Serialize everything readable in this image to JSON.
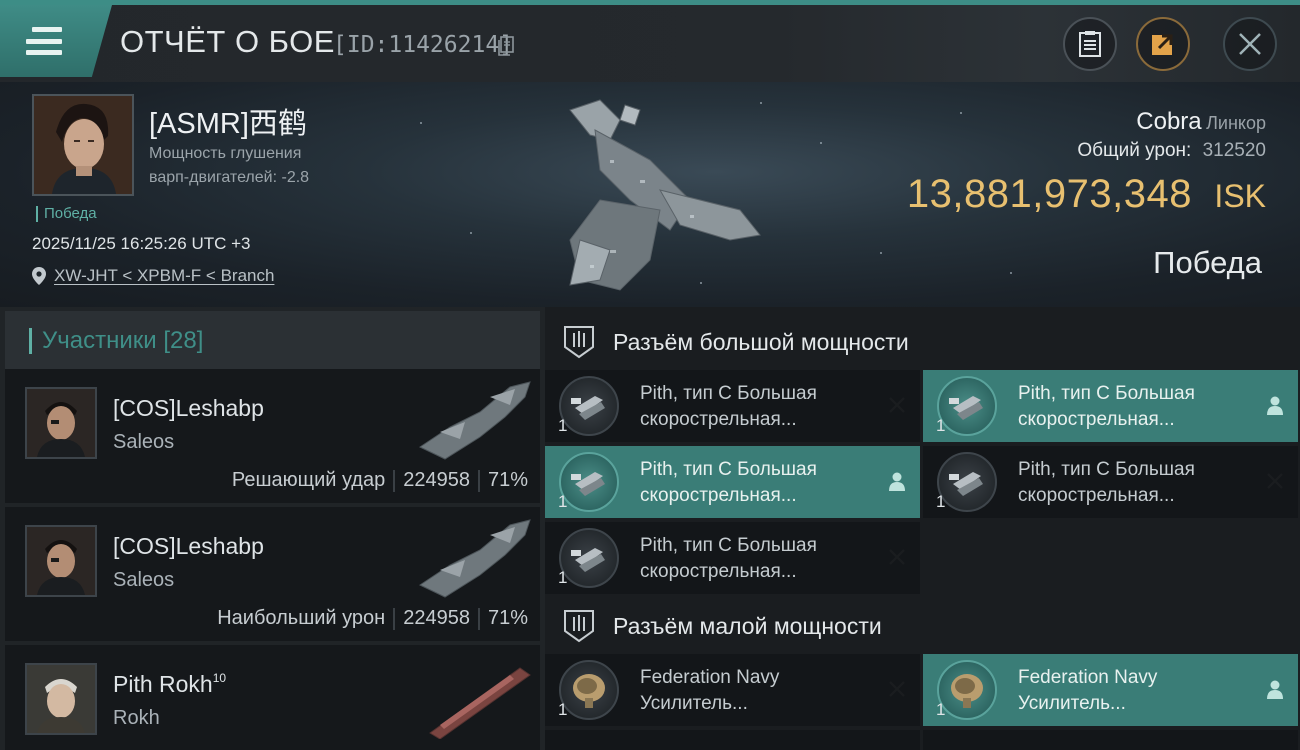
{
  "header": {
    "title": "ОТЧЁТ О БОЕ",
    "report_id": "[ID:11426214]"
  },
  "hero": {
    "pilot_name": "[ASMR]西鹤",
    "stat_line1": "Мощность глушения",
    "stat_line2": "варп-двигателей: -2.8",
    "status_tag": "Победа",
    "timestamp": "2025/11/25 16:25:26 UTC +3",
    "location": "XW-JHT < XPBM-F < Branch",
    "ship_name": "Cobra",
    "ship_class": "Линкор",
    "damage_label": "Общий урон:",
    "damage_value": "312520",
    "isk_value": "13,881,973,348",
    "isk_unit": "ISK",
    "result": "Победа"
  },
  "participants": {
    "title": "Участники [28]",
    "items": [
      {
        "name": "[COS]Leshabp",
        "sup": "",
        "ship": "Saleos",
        "role": "Решающий удар",
        "damage": "224958",
        "percent": "71%"
      },
      {
        "name": "[COS]Leshabp",
        "sup": "",
        "ship": "Saleos",
        "role": "Наибольший урон",
        "damage": "224958",
        "percent": "71%"
      },
      {
        "name": "Pith Rokh",
        "sup": "10",
        "ship": "Rokh",
        "role": "",
        "damage": "",
        "percent": ""
      }
    ]
  },
  "slots": {
    "high": {
      "title": "Разъём большой мощности",
      "modules": [
        {
          "line1": "Pith, тип C Большая",
          "line2": "скорострельная...",
          "qty": "1",
          "state": "destroyed"
        },
        {
          "line1": "Pith, тип C Большая",
          "line2": "скорострельная...",
          "qty": "1",
          "state": "dropped"
        },
        {
          "line1": "Pith, тип C Большая",
          "line2": "скорострельная...",
          "qty": "1",
          "state": "dropped"
        },
        {
          "line1": "Pith, тип C Большая",
          "line2": "скорострельная...",
          "qty": "1",
          "state": "destroyed"
        },
        {
          "line1": "Pith, тип C Большая",
          "line2": "скорострельная...",
          "qty": "1",
          "state": "destroyed"
        }
      ]
    },
    "low": {
      "title": "Разъём малой мощности",
      "modules": [
        {
          "line1": "Federation Navy",
          "line2": "Усилитель...",
          "qty": "1",
          "state": "destroyed"
        },
        {
          "line1": "Federation Navy",
          "line2": "Усилитель...",
          "qty": "1",
          "state": "dropped"
        }
      ]
    }
  },
  "colors": {
    "accent": "#3d8d86",
    "isk": "#e8c070"
  }
}
